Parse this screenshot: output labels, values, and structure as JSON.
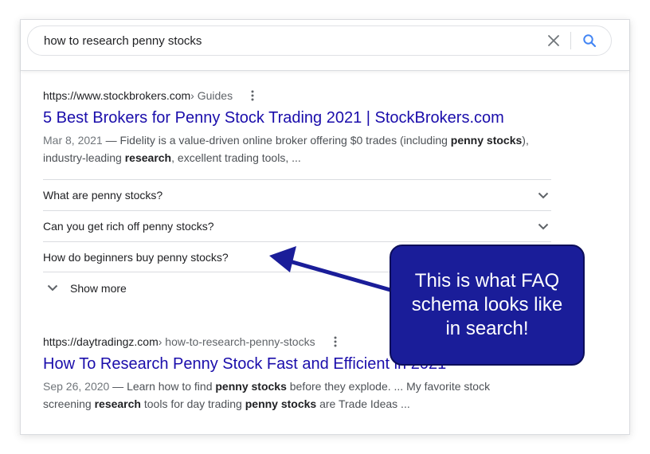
{
  "search": {
    "query": "how to research penny stocks",
    "clear_icon": "close-icon",
    "search_icon": "search-icon",
    "accent_color": "#4285f4"
  },
  "results": [
    {
      "url": "https://www.stockbrokers.com",
      "breadcrumb": " › Guides",
      "title": "5 Best Brokers for Penny Stock Trading 2021 | StockBrokers.com",
      "date": "Mar 8, 2021",
      "snippet_1": " — Fidelity is a value-driven online broker offering $0 trades (including ",
      "bold_1": "penny stocks",
      "snippet_2": "), industry-leading ",
      "bold_2": "research",
      "snippet_3": ", excellent trading tools, ..."
    },
    {
      "url": "https://daytradingz.com",
      "breadcrumb": " › how-to-research-penny-stocks",
      "title": "How To Research Penny Stock Fast and Efficient in 2021",
      "date": "Sep 26, 2020",
      "snippet_1": " — Learn how to find ",
      "bold_1": "penny stocks",
      "snippet_2": " before they explode. ... My favorite stock screening ",
      "bold_2": "research",
      "snippet_3": " tools for day trading ",
      "bold_3": "penny stocks",
      "snippet_4": " are Trade Ideas ..."
    }
  ],
  "faq": {
    "items": [
      "What are penny stocks?",
      "Can you get rich off penny stocks?",
      "How do beginners buy penny stocks?"
    ],
    "show_more": "Show more"
  },
  "callout": {
    "text": "This is what FAQ schema looks like in search!",
    "color": "#1a1d99"
  },
  "colors": {
    "link": "#1a0dab",
    "snippet": "#4d5156",
    "border": "#dadce0"
  }
}
